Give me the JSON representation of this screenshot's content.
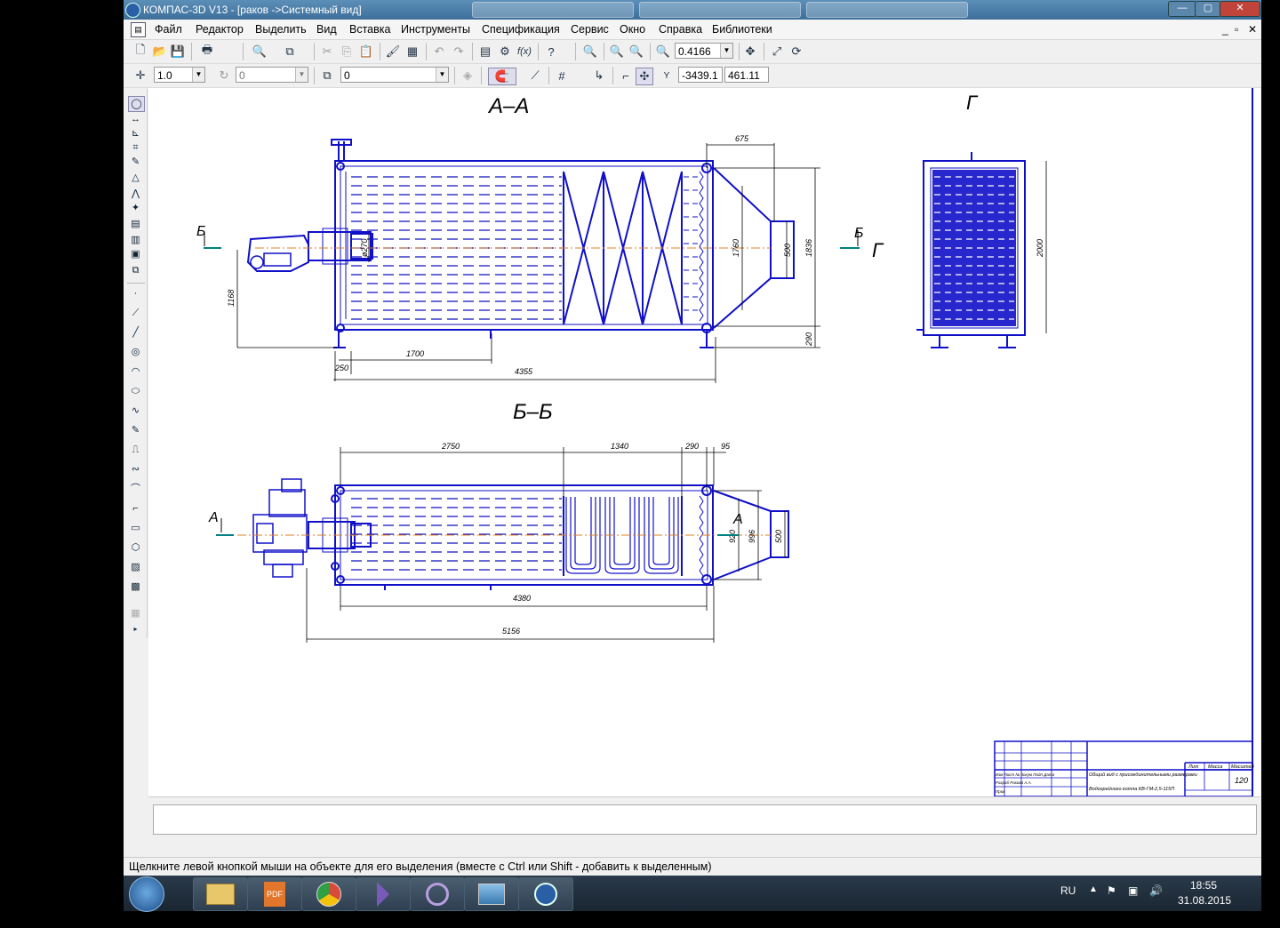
{
  "window": {
    "title": "КОМПАС-3D V13 - [раков ->Системный вид]",
    "controls": {
      "minimize": "—",
      "maximize": "▢",
      "close": "✕"
    },
    "doc_controls": {
      "minimize": "_",
      "restore": "▫",
      "close": "✕"
    }
  },
  "menu": {
    "items": [
      "Файл",
      "Редактор",
      "Выделить",
      "Вид",
      "Вставка",
      "Инструменты",
      "Спецификация",
      "Сервис",
      "Окно",
      "Справка",
      "Библиотеки"
    ]
  },
  "toolbar": {
    "zoom_value": "0.4166",
    "step_value": "1.0",
    "angle_value": "0",
    "layer_value": "0",
    "coord_x": "-3439.1",
    "coord_y": "461.11"
  },
  "drawing": {
    "section_aa": "А–А",
    "section_bb": "Б–Б",
    "view_g": "Г",
    "view_g_arrow": "Г",
    "marker_b": "Б",
    "marker_a": "А",
    "dims_top": {
      "d675": "675",
      "d1760": "1760",
      "d500": "500",
      "d1836": "1836",
      "d290": "290",
      "d270": "ø270",
      "d1168": "1168",
      "d1700": "1700",
      "d250": "250",
      "d4355": "4355",
      "d2000": "2000"
    },
    "dims_bottom": {
      "d2750": "2750",
      "d1340": "1340",
      "d290": "290",
      "d95": "95",
      "d920": "920",
      "d996": "996",
      "d500": "500",
      "d4380": "4380",
      "d5156": "5156"
    },
    "title_block": {
      "description": "Общий вид с присоединительными размерами",
      "product": "Водогрейного котла КВ-ГМ-2,5-115П",
      "col_lit": "Лит",
      "col_mass": "Масса",
      "col_scale": "Масштаб",
      "mass_value": "120",
      "row1": "Изм Лист  № докум  Подп  Дата",
      "row2": "Разраб  Ракова А.А.",
      "row3": "Пров"
    }
  },
  "status": {
    "hint": "Щелкните левой кнопкой мыши на объекте для его выделения (вместе с Ctrl или Shift - добавить к выделенным)"
  },
  "taskbar": {
    "apps": [
      "explorer-icon",
      "pdf-icon",
      "chrome-icon",
      "vs-icon",
      "app-icon",
      "photo-icon",
      "kompas-icon"
    ],
    "lang": "RU",
    "time": "18:55",
    "date": "31.08.2015"
  },
  "colors": {
    "drawing_line": "#1010c8",
    "titlebar": "#4a7eaa",
    "canvas_border": "#1010c8",
    "axis": "#e08020",
    "section_mark": "#008080"
  }
}
